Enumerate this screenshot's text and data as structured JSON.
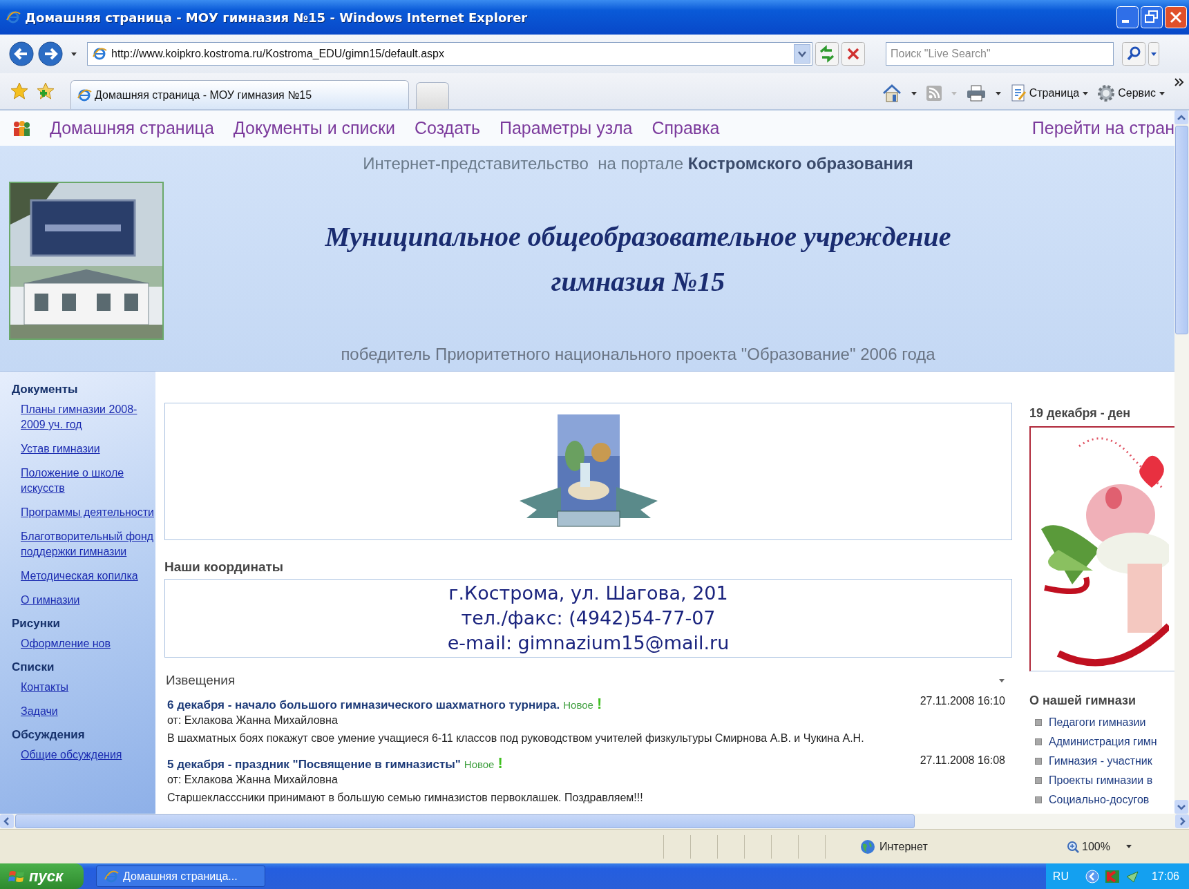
{
  "window": {
    "title": "Домашняя страница - МОУ гимназия №15 - Windows Internet Explorer"
  },
  "address_bar": {
    "url": "http://www.koipkro.kostroma.ru/Kostroma_EDU/gimn15/default.aspx"
  },
  "search": {
    "placeholder": "Поиск \"Live Search\""
  },
  "tabs": [
    {
      "label": "Домашняя страница - МОУ гимназия №15",
      "selected": true
    }
  ],
  "command_bar": {
    "items": [
      "Страница",
      "Сервис"
    ]
  },
  "site_nav": {
    "items": [
      "Домашняя страница",
      "Документы и списки",
      "Создать",
      "Параметры узла",
      "Справка"
    ],
    "goto": "Перейти на стран"
  },
  "header": {
    "portal_line": "Интернет-представительство  на портале **Костромского образования**",
    "title_lines": [
      "Муниципальное общеобразовательное учреждение",
      "гимназия №15"
    ],
    "subtitle": "победитель Приоритетного национального проекта \"Образование\" 2006 года"
  },
  "sidebar": {
    "groups": [
      {
        "heading": "Документы",
        "items": [
          "Планы гимназии 2008-2009 уч. год",
          "Устав гимназии",
          "Положение о школе искусств",
          "Программы деятельности",
          "Благотворительный фонд поддержки гимназии",
          "Методическая копилка",
          "О гимназии"
        ]
      },
      {
        "heading": "Рисунки",
        "items": [
          "Оформление  нов"
        ]
      },
      {
        "heading": "Списки",
        "items": [
          "Контакты",
          "Задачи"
        ]
      },
      {
        "heading": "Обсуждения",
        "items": [
          "Общие обсуждения"
        ]
      }
    ]
  },
  "coordinates": {
    "heading": "Наши координаты",
    "lines": [
      "г.Кострома, ул. Шагова, 201",
      "тел./факс: (4942)54-77-07",
      "e-mail: gimnazium15@mail.ru"
    ]
  },
  "announcements": {
    "heading": "Извещения",
    "items": [
      {
        "title": "6 декабря - начало большого гимназического шахматного турнира.",
        "badge": "Новое",
        "badge_mark": "!",
        "author": "от: Ехлакова Жанна Михайловна",
        "date": "27.11.2008 16:10",
        "body": "В шахматных боях покажут свое умение учащиеся 6-11 классов под руководством учителей физкультуры Смирнова А.В. и Чукина А.Н."
      },
      {
        "title": "5 декабря - праздник \"Посвящение в гимназисты\"",
        "badge": "Новое",
        "badge_mark": "!",
        "author": "от: Ехлакова Жанна Михайловна",
        "date": "27.11.2008 16:08",
        "body": "Старшеклассcники принимают в большую семью гимназистов первоклашек. Поздравляем!!!"
      }
    ]
  },
  "right_column": {
    "promo_title": "19 декабря - ден",
    "about_heading": "О нашей гимнази",
    "links": [
      "Педагоги гимназии",
      "Администрация гимн",
      "Гимназия - участник",
      "Проекты гимназии в",
      "Социально-досугов"
    ]
  },
  "status_bar": {
    "zone": "Интернет",
    "zoom": "100%"
  },
  "taskbar": {
    "start": "пуск",
    "tasks": [
      "Домашняя страница..."
    ],
    "language": "RU",
    "clock": "17:06"
  }
}
